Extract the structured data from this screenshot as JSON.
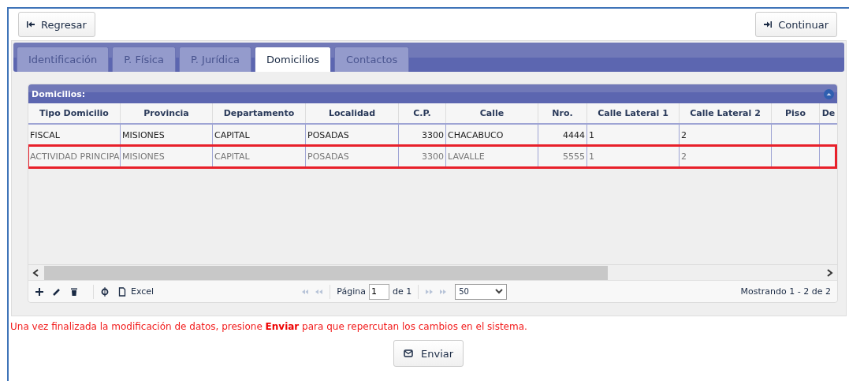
{
  "top_buttons": [
    {
      "label": "Regresar",
      "kind": "back"
    },
    {
      "label": "Continuar",
      "kind": "forward"
    }
  ],
  "tabs": [
    {
      "label": "Identificación",
      "selected": false
    },
    {
      "label": "P. Física",
      "selected": false
    },
    {
      "label": "P. Jurídica",
      "selected": false
    },
    {
      "label": "Domicilios",
      "selected": true
    },
    {
      "label": "Contactos",
      "selected": false
    }
  ],
  "grid": {
    "title": "Domicilios:",
    "columns": [
      {
        "label": "Tipo Domicilio",
        "right_aligned": false
      },
      {
        "label": "Provincia",
        "right_aligned": false
      },
      {
        "label": "Departamento",
        "right_aligned": false
      },
      {
        "label": "Localidad",
        "right_aligned": false
      },
      {
        "label": "C.P.",
        "right_aligned": true
      },
      {
        "label": "Calle",
        "right_aligned": false
      },
      {
        "label": "Nro.",
        "right_aligned": true
      },
      {
        "label": "Calle Lateral 1",
        "right_aligned": false
      },
      {
        "label": "Calle Lateral 2",
        "right_aligned": false
      },
      {
        "label": "Piso"
      },
      {
        "label": "De"
      }
    ],
    "rows": [
      {
        "highlighted": false,
        "cells": [
          "FISCAL",
          "MISIONES",
          "CAPITAL",
          "POSADAS",
          "3300",
          "CHACABUCO",
          "4444",
          "1",
          "2"
        ]
      },
      {
        "highlighted": true,
        "cells": [
          "ACTIVIDAD PRINCIPA",
          "MISIONES",
          "CAPITAL",
          "POSADAS",
          "3300",
          "LAVALLE",
          "5555",
          "1",
          "2"
        ]
      }
    ],
    "toolbar": {
      "excel": "Excel",
      "page_label": "Página",
      "page": "1",
      "of_label": "de 1",
      "page_size": "50",
      "summary": "Mostrando 1 - 2 de 2"
    }
  },
  "message": "Una vez finalizada la modificación de datos, presione **Enviar** para que repercutan los cambios en el sistema.",
  "submit": "Enviar"
}
